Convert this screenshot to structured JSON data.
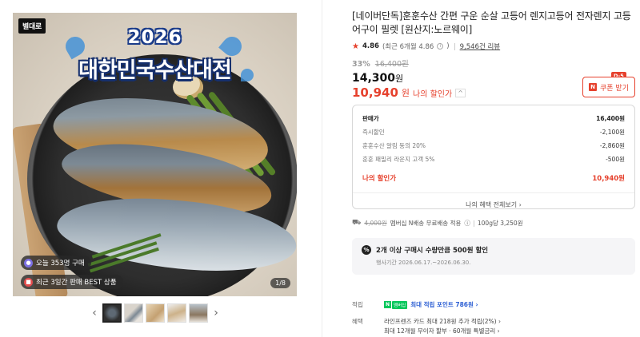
{
  "image": {
    "brand_logo": "별대로",
    "event_year": "2026",
    "event_title": "대한민국수산대전",
    "stat_today": "오늘 353명 구매",
    "stat_best": "최근 3일간 판매 BEST 상품",
    "counter": "1/8"
  },
  "thumbnails": {
    "prev": "‹",
    "next": "›",
    "count": 5,
    "active_index": 0
  },
  "product": {
    "title": "[네이버단독]훈훈수산 간편 구운 순살 고등어 렌지고등어 전자렌지 고등어구이 필렛 [원산지:노르웨이]",
    "rating": "4.86",
    "rating_detail": "(최근 6개월 4.86",
    "rating_detail_close": ")",
    "review_count": "9,546건 리뷰",
    "discount_pct": "33%",
    "original_price": "16,400원",
    "sale_price": "14,300",
    "sale_price_unit": "원",
    "my_price": "10,940",
    "my_price_unit": "원",
    "my_price_label": "나의 할인가",
    "my_price_caret": "^"
  },
  "coupon": {
    "dday": "D-5",
    "label": "쿠폰 받기",
    "n_badge": "N"
  },
  "breakdown": {
    "rows": [
      {
        "label": "판매가",
        "value": "16,400원"
      },
      {
        "label": "즉시할인",
        "value": "-2,100원"
      },
      {
        "label": "훈훈수산 알림 동의 20%",
        "value": "-2,860원"
      },
      {
        "label": "훈훈 패밀리 라운지 고객 5%",
        "value": "-500원"
      }
    ],
    "mine_label": "나의 할인가",
    "mine_value": "10,940원",
    "more_link": "나의 혜택 전체보기 ›"
  },
  "shipping": {
    "orig_fee": "4,000원",
    "text": "멤버십 N배송 무료배송 적용",
    "info": "ⓘ",
    "unit_price": "100g당 3,250원"
  },
  "promo": {
    "title": "2개 이상 구매시 수량만큼 500원 할인",
    "period": "행사기간 2026.06.17.~2026.06.30."
  },
  "benefits": {
    "points_label": "적립",
    "n_badge": "N",
    "membership_badge": "멤버십",
    "points_text": "최대 적립 포인트 786원 ›",
    "card_label": "혜택",
    "card_line1": "라인프렌즈 카드 최대 218원 추가 적립(2%) ›",
    "card_line2": "최대 12개월 무이자 할부 · 60개월 특별금리 ›"
  },
  "colors": {
    "accent_red": "#e6412d",
    "link_blue": "#2d5fd3",
    "naver_green": "#03c75a"
  }
}
